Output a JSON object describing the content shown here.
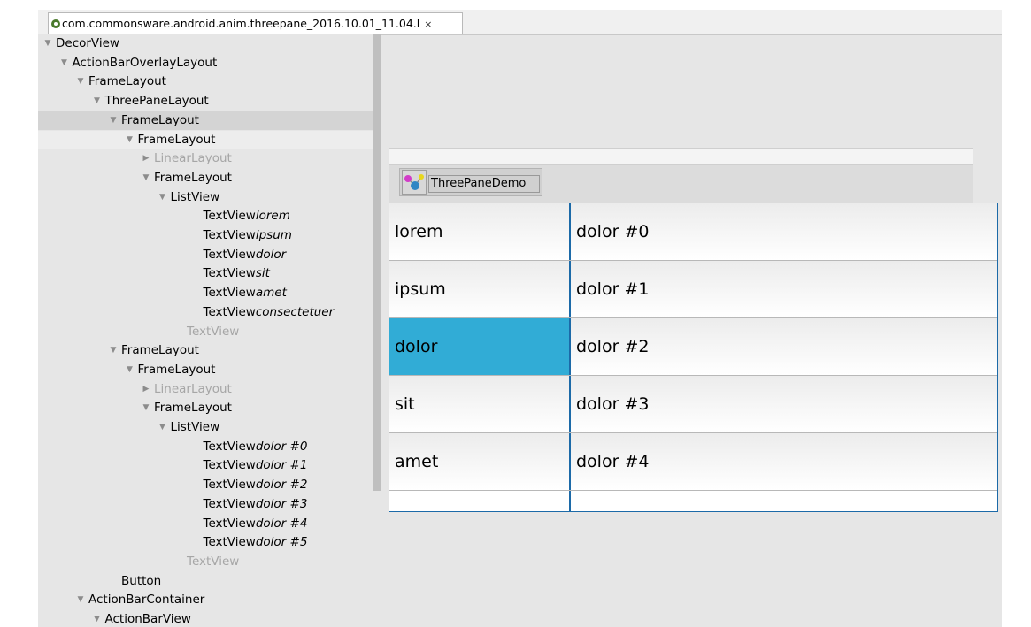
{
  "tab": {
    "title": "com.commonsware.android.anim.threepane_2016.10.01_11.04.l",
    "close": "×"
  },
  "tree": [
    {
      "depth": 0,
      "arrow": "down",
      "label": "DecorView"
    },
    {
      "depth": 1,
      "arrow": "down",
      "label": "ActionBarOverlayLayout"
    },
    {
      "depth": 2,
      "arrow": "down",
      "label": "FrameLayout"
    },
    {
      "depth": 3,
      "arrow": "down",
      "label": "ThreePaneLayout"
    },
    {
      "depth": 4,
      "arrow": "down",
      "label": "FrameLayout",
      "style": "highlight"
    },
    {
      "depth": 5,
      "arrow": "down",
      "label": "FrameLayout",
      "style": "subhighlight"
    },
    {
      "depth": 6,
      "arrow": "right",
      "label": "LinearLayout",
      "dim": true
    },
    {
      "depth": 6,
      "arrow": "down",
      "label": "FrameLayout"
    },
    {
      "depth": 7,
      "arrow": "down",
      "label": "ListView"
    },
    {
      "depth": 9,
      "arrow": "",
      "label": "TextView",
      "tag": "lorem"
    },
    {
      "depth": 9,
      "arrow": "",
      "label": "TextView",
      "tag": "ipsum"
    },
    {
      "depth": 9,
      "arrow": "",
      "label": "TextView",
      "tag": "dolor"
    },
    {
      "depth": 9,
      "arrow": "",
      "label": "TextView",
      "tag": "sit"
    },
    {
      "depth": 9,
      "arrow": "",
      "label": "TextView",
      "tag": "amet"
    },
    {
      "depth": 9,
      "arrow": "",
      "label": "TextView",
      "tag": "consectetuer"
    },
    {
      "depth": 8,
      "arrow": "",
      "label": "TextView",
      "dim": true
    },
    {
      "depth": 4,
      "arrow": "down",
      "label": "FrameLayout"
    },
    {
      "depth": 5,
      "arrow": "down",
      "label": "FrameLayout"
    },
    {
      "depth": 6,
      "arrow": "right",
      "label": "LinearLayout",
      "dim": true
    },
    {
      "depth": 6,
      "arrow": "down",
      "label": "FrameLayout"
    },
    {
      "depth": 7,
      "arrow": "down",
      "label": "ListView"
    },
    {
      "depth": 9,
      "arrow": "",
      "label": "TextView",
      "tag": "dolor #0"
    },
    {
      "depth": 9,
      "arrow": "",
      "label": "TextView",
      "tag": "dolor #1"
    },
    {
      "depth": 9,
      "arrow": "",
      "label": "TextView",
      "tag": "dolor #2"
    },
    {
      "depth": 9,
      "arrow": "",
      "label": "TextView",
      "tag": "dolor #3"
    },
    {
      "depth": 9,
      "arrow": "",
      "label": "TextView",
      "tag": "dolor #4"
    },
    {
      "depth": 9,
      "arrow": "",
      "label": "TextView",
      "tag": "dolor #5"
    },
    {
      "depth": 8,
      "arrow": "",
      "label": "TextView",
      "dim": true
    },
    {
      "depth": 4,
      "arrow": "",
      "label": "Button"
    },
    {
      "depth": 2,
      "arrow": "down",
      "label": "ActionBarContainer"
    },
    {
      "depth": 3,
      "arrow": "down",
      "label": "ActionBarView"
    }
  ],
  "preview": {
    "app_title": "ThreePaneDemo",
    "accent_color": "#31acd6",
    "rows": [
      {
        "left": "lorem",
        "right": "dolor #0",
        "selected": false
      },
      {
        "left": "ipsum",
        "right": "dolor #1",
        "selected": false
      },
      {
        "left": "dolor",
        "right": "dolor #2",
        "selected": true
      },
      {
        "left": "sit",
        "right": "dolor #3",
        "selected": false
      },
      {
        "left": "amet",
        "right": "dolor #4",
        "selected": false
      }
    ]
  }
}
